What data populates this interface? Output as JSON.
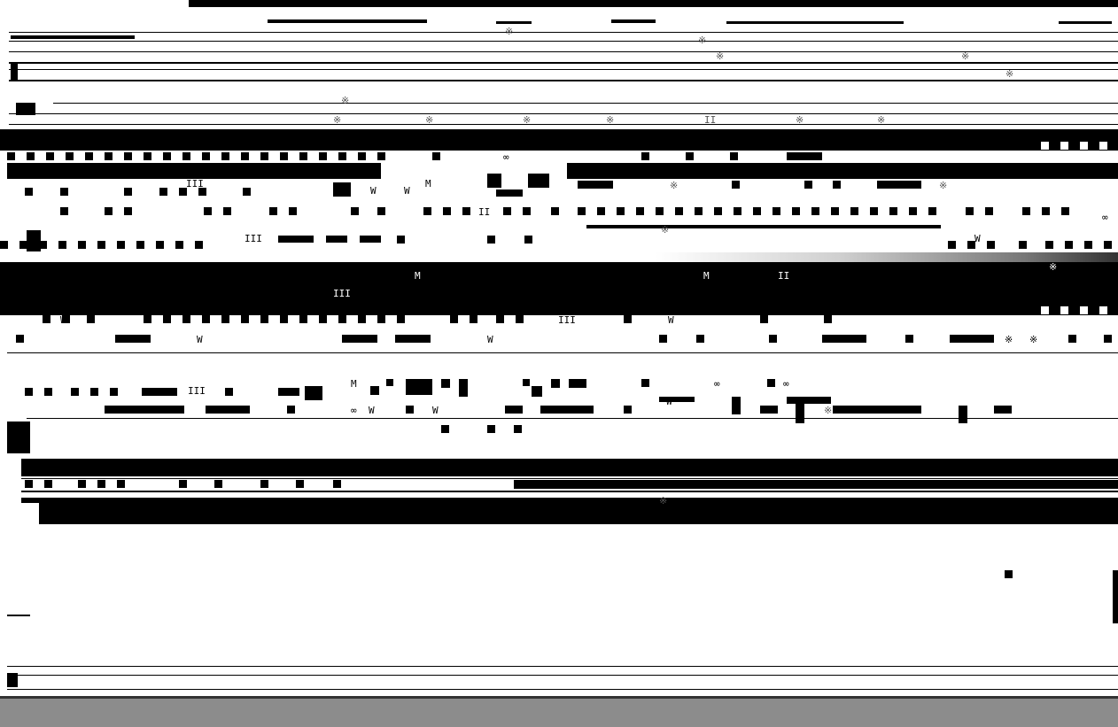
{
  "glyphs": {
    "mark_w": "W",
    "mark_m": "M",
    "mark_ii": "II",
    "mark_iii": "III",
    "mark_oo": "∞",
    "mark_x": "※"
  },
  "colors": {
    "background": "#ffffff",
    "ink": "#000000",
    "statusbar": "#8c8c8c"
  }
}
